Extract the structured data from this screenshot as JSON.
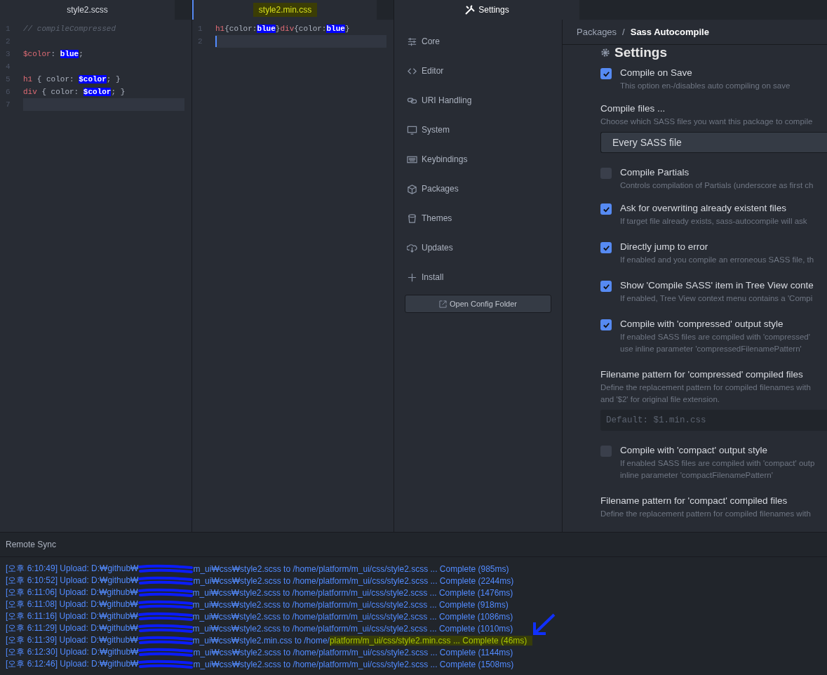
{
  "editors": [
    {
      "tab": {
        "label": "style2.scss",
        "highlighted": false
      },
      "lines": [
        {
          "number": "1",
          "current": false,
          "tokens": [
            {
              "kind": "comment",
              "text": "// compileCompressed"
            }
          ]
        },
        {
          "number": "2",
          "current": false
        },
        {
          "number": "3",
          "current": false,
          "tokens": [
            {
              "kind": "keyword",
              "text": "$color"
            },
            {
              "kind": "plain",
              "text": ": "
            },
            {
              "kind": "match",
              "text": "blue"
            },
            {
              "kind": "plain",
              "text": ";"
            }
          ]
        },
        {
          "number": "4",
          "current": false
        },
        {
          "number": "5",
          "current": false,
          "tokens": [
            {
              "kind": "keyword",
              "text": "h1"
            },
            {
              "kind": "plain",
              "text": " { color: "
            },
            {
              "kind": "match",
              "text": "$color"
            },
            {
              "kind": "plain",
              "text": "; }"
            }
          ]
        },
        {
          "number": "6",
          "current": false,
          "tokens": [
            {
              "kind": "keyword",
              "text": "div"
            },
            {
              "kind": "plain",
              "text": " { color: "
            },
            {
              "kind": "match",
              "text": "$color"
            },
            {
              "kind": "plain",
              "text": "; }"
            }
          ]
        },
        {
          "number": "7",
          "current": true
        }
      ]
    },
    {
      "tab": {
        "label": "style2.min.css",
        "highlighted": true
      },
      "lines": [
        {
          "number": "1",
          "current": false,
          "tokens": [
            {
              "kind": "keyword",
              "text": "h1"
            },
            {
              "kind": "plain",
              "text": "{color:"
            },
            {
              "kind": "match",
              "text": "blue"
            },
            {
              "kind": "plain",
              "text": "}"
            },
            {
              "kind": "keyword",
              "text": "div"
            },
            {
              "kind": "plain",
              "text": "{color:"
            },
            {
              "kind": "match",
              "text": "blue"
            },
            {
              "kind": "plain",
              "text": "}"
            }
          ]
        },
        {
          "number": "2",
          "current": true
        }
      ]
    }
  ],
  "settings": {
    "tab": "Settings",
    "menu": [
      {
        "label": "Core"
      },
      {
        "label": "Editor"
      },
      {
        "label": "URI Handling"
      },
      {
        "label": "System"
      },
      {
        "label": "Keybindings"
      },
      {
        "label": "Packages"
      },
      {
        "label": "Themes"
      },
      {
        "label": "Updates"
      },
      {
        "label": "Install"
      }
    ],
    "open_config_button": "Open Config Folder",
    "breadcrumb": {
      "parent": "Packages",
      "separator": "/",
      "current": "Sass Autocompile"
    },
    "section_title": "Settings",
    "items": [
      {
        "kind": "checkbox",
        "checked": true,
        "title": "Compile on Save",
        "description": [
          "This option en-/disables auto compiling on save"
        ]
      },
      {
        "kind": "select",
        "title": "Compile files ...",
        "description": [
          "Choose which SASS files you want this package to compile"
        ],
        "value": "Every SASS file"
      },
      {
        "kind": "checkbox",
        "checked": false,
        "title": "Compile Partials",
        "description": [
          "Controls compilation of Partials (underscore as first ch"
        ]
      },
      {
        "kind": "checkbox",
        "checked": true,
        "title": "Ask for overwriting already existent files",
        "description": [
          "If target file already exists, sass-autocompile will ask"
        ]
      },
      {
        "kind": "checkbox",
        "checked": true,
        "title": "Directly jump to error",
        "description": [
          "If enabled and you compile an erroneous SASS file, th"
        ]
      },
      {
        "kind": "checkbox",
        "checked": true,
        "title": "Show 'Compile SASS' item in Tree View conte",
        "description": [
          "If enabled, Tree View context menu contains a 'Compi"
        ]
      },
      {
        "kind": "checkbox",
        "checked": true,
        "title": "Compile with 'compressed' output style",
        "description": [
          "If enabled SASS files are compiled with 'compressed'",
          "use inline parameter 'compressedFilenamePattern'"
        ]
      },
      {
        "kind": "text",
        "title": "Filename pattern for 'compressed' compiled files",
        "description": [
          "Define the replacement pattern for compiled filenames with",
          "and '$2' for original file extension."
        ],
        "placeholder": "Default: $1.min.css"
      },
      {
        "kind": "checkbox",
        "checked": false,
        "title": "Compile with 'compact' output style",
        "description": [
          "If enabled SASS files are compiled with 'compact' outp",
          "inline parameter 'compactFilenamePattern'"
        ]
      },
      {
        "kind": "heading",
        "title": "Filename pattern for 'compact' compiled files",
        "description": [
          "Define the replacement pattern for compiled filenames with"
        ]
      }
    ]
  },
  "remote_sync": {
    "title": "Remote Sync",
    "log": [
      {
        "before": "[오후 6:10:49] Upload: D:₩github₩",
        "after": "m_ui₩css₩style2.scss to /home/platform/m_ui/css/style2.scss ... Complete (985ms)"
      },
      {
        "before": "[오후 6:10:52] Upload: D:₩github₩",
        "after": "m_ui₩css₩style2.scss to /home/platform/m_ui/css/style2.scss ... Complete (2244ms)"
      },
      {
        "before": "[오후 6:11:06] Upload: D:₩github₩",
        "after": "m_ui₩css₩style2.scss to /home/platform/m_ui/css/style2.scss ... Complete (1476ms)"
      },
      {
        "before": "[오후 6:11:08] Upload: D:₩github₩",
        "after": "m_ui₩css₩style2.scss to /home/platform/m_ui/css/style2.scss ... Complete (918ms)"
      },
      {
        "before": "[오후 6:11:16] Upload: D:₩github₩",
        "after": "m_ui₩css₩style2.scss to /home/platform/m_ui/css/style2.scss ... Complete (1086ms)"
      },
      {
        "before": "[오후 6:11:29] Upload: D:₩github₩",
        "after": "m_ui₩css₩style2.scss to /home/platform/m_ui/css/style2.scss ... Complete (1010ms)"
      },
      {
        "before": "[오후 6:11:39] Upload: D:₩github₩",
        "after": "m_ui₩css₩style2.min.css to /home/",
        "highlight": "platform/m_ui/css/style2.min.css ... Complete (46ms)"
      },
      {
        "before": "[오후 6:12:30] Upload: D:₩github₩",
        "after": "m_ui₩css₩style2.scss to /home/platform/m_ui/css/style2.scss ... Complete (1144ms)"
      },
      {
        "before": "[오후 6:12:46] Upload: D:₩github₩",
        "after": "m_ui₩css₩style2.scss to /home/platform/m_ui/css/style2.scss ... Complete (1508ms)"
      }
    ]
  }
}
